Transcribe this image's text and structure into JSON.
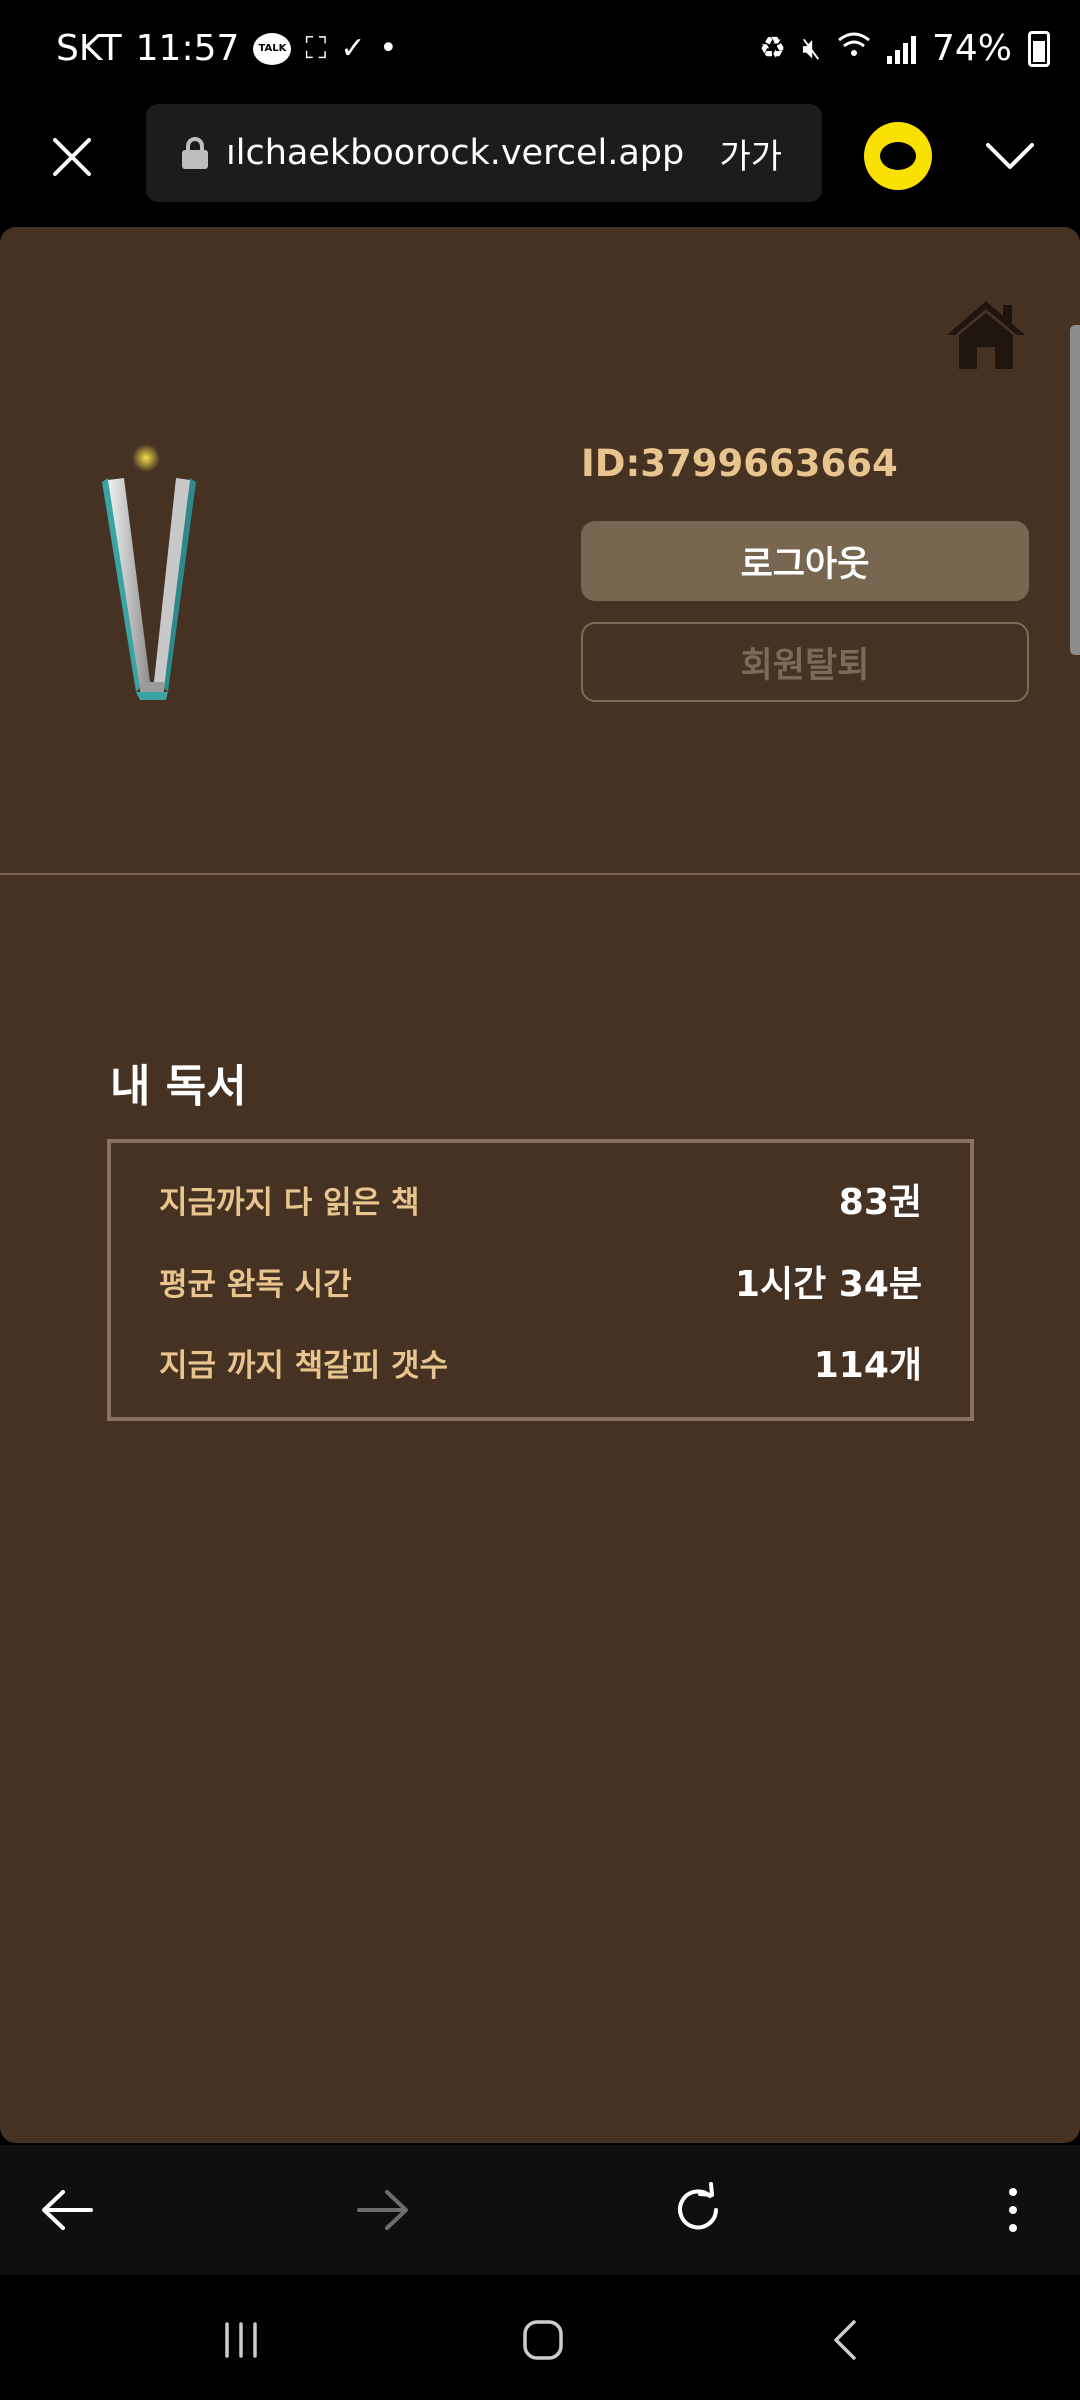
{
  "status_bar": {
    "carrier": "SKT",
    "time": "11:57",
    "talk_badge": "TALK",
    "battery_percent": "74%",
    "icons": [
      "talk-icon",
      "screenshot-icon",
      "check-icon",
      "dot-icon",
      "battery-saver-icon",
      "mute-icon",
      "wifi-icon",
      "signal-icon",
      "battery-icon"
    ]
  },
  "browser": {
    "url": "ılchaekboorock.vercel.app",
    "text_size_label": "가가",
    "icons": [
      "close-icon",
      "lock-icon",
      "kakao-talk-icon",
      "chevron-down-icon"
    ]
  },
  "profile": {
    "user_id": "ID:3799663664",
    "logout_label": "로그아웃",
    "withdraw_label": "회원탈퇴"
  },
  "reading": {
    "title": "내 독서",
    "stats": [
      {
        "label": "지금까지 다 읽은 책",
        "value": "83권"
      },
      {
        "label": "평균 완독 시간",
        "value": "1시간 34분"
      },
      {
        "label": "지금 까지 책갈피 갯수",
        "value": "114개"
      }
    ]
  },
  "colors": {
    "page_bg": "#453223",
    "accent_gold": "#e8c48e",
    "logout_bg": "#776650",
    "kakao_yellow": "#fae100"
  }
}
